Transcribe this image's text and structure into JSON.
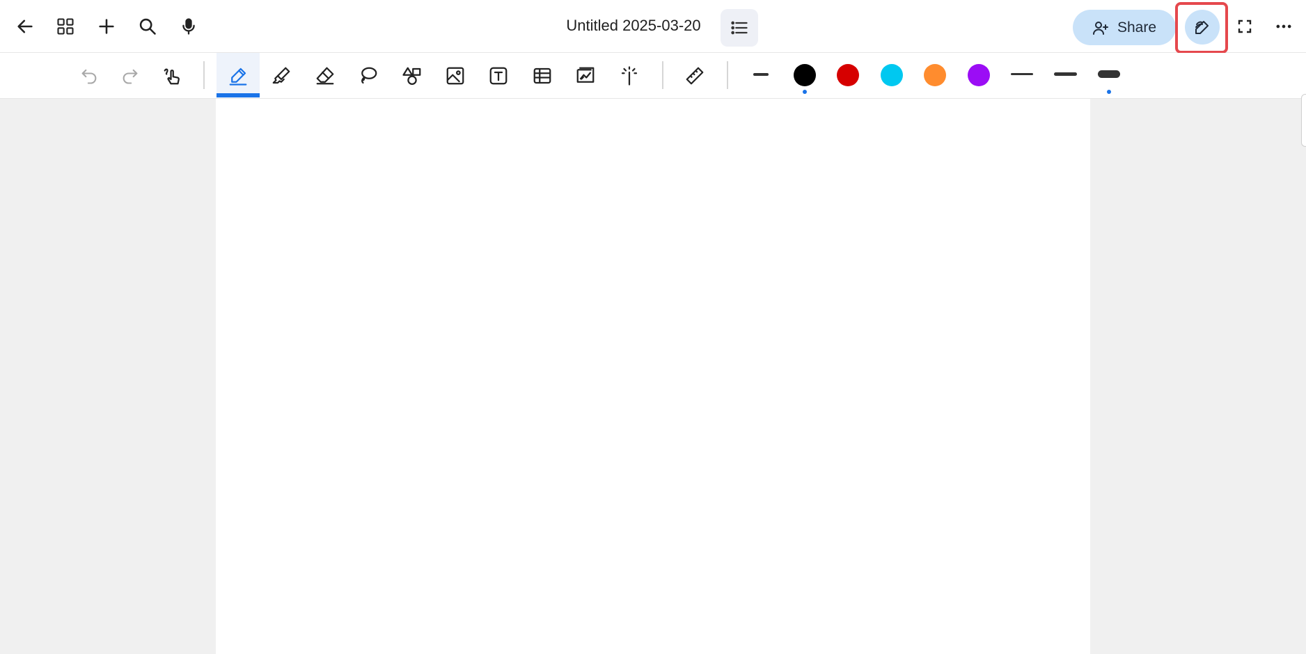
{
  "document": {
    "title": "Untitled 2025-03-20"
  },
  "header": {
    "share_label": "Share"
  },
  "icons": {
    "back": "back-arrow-icon",
    "grid": "grid-icon",
    "add": "plus-icon",
    "search": "search-icon",
    "mic": "microphone-icon",
    "outline": "list-icon",
    "share": "person-add-icon",
    "pen_mode": "pen-edit-icon",
    "fullscreen": "fullscreen-icon",
    "more": "more-horizontal-icon"
  },
  "toolbar": {
    "tools": [
      "undo-icon",
      "redo-icon",
      "touch-draw-icon",
      "pen-icon",
      "highlighter-icon",
      "eraser-icon",
      "lasso-icon",
      "shapes-icon",
      "image-icon",
      "text-box-icon",
      "table-icon",
      "chart-icon",
      "laser-pointer-icon",
      "ruler-icon"
    ],
    "active_tool": "pen",
    "colors": [
      "#000000",
      "#d60000",
      "#00c8f0",
      "#ff8c2e",
      "#9b0df5"
    ],
    "selected_color": "#000000",
    "stroke_widths": [
      "thin",
      "medium",
      "thick"
    ],
    "selected_stroke_width": "thick"
  },
  "accent_color": "#1a73e8",
  "highlight_color": "#e5484d"
}
